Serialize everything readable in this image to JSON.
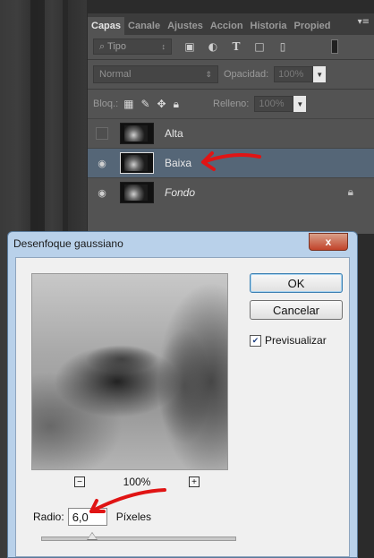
{
  "panel": {
    "tabs": [
      "Capas",
      "Canale",
      "Ajustes",
      "Accion",
      "Historia",
      "Propied"
    ],
    "active_tab": "Capas",
    "filter": {
      "label": "⌕ Tipo",
      "arrow": "↕"
    },
    "blend_mode": "Normal",
    "opacity_label": "Opacidad:",
    "opacity_value": "100%",
    "lock_label": "Bloq.:",
    "fill_label": "Relleno:",
    "fill_value": "100%",
    "layers": [
      {
        "name": "Alta",
        "visible": false,
        "selected": false,
        "italic": false
      },
      {
        "name": "Baixa",
        "visible": true,
        "selected": true,
        "italic": false
      },
      {
        "name": "Fondo",
        "visible": true,
        "selected": false,
        "italic": true,
        "locked": true
      }
    ],
    "selected_color": "#556677"
  },
  "dialog": {
    "title": "Desenfoque gaussiano",
    "close": "x",
    "ok": "OK",
    "cancel": "Cancelar",
    "preview_label": "Previsualizar",
    "preview_checked": true,
    "zoom": "100%",
    "radius_label": "Radio:",
    "radius_value": "6,0",
    "units": "Píxeles",
    "radius_fraction": 0.26
  },
  "annotation_color": "#e01414"
}
